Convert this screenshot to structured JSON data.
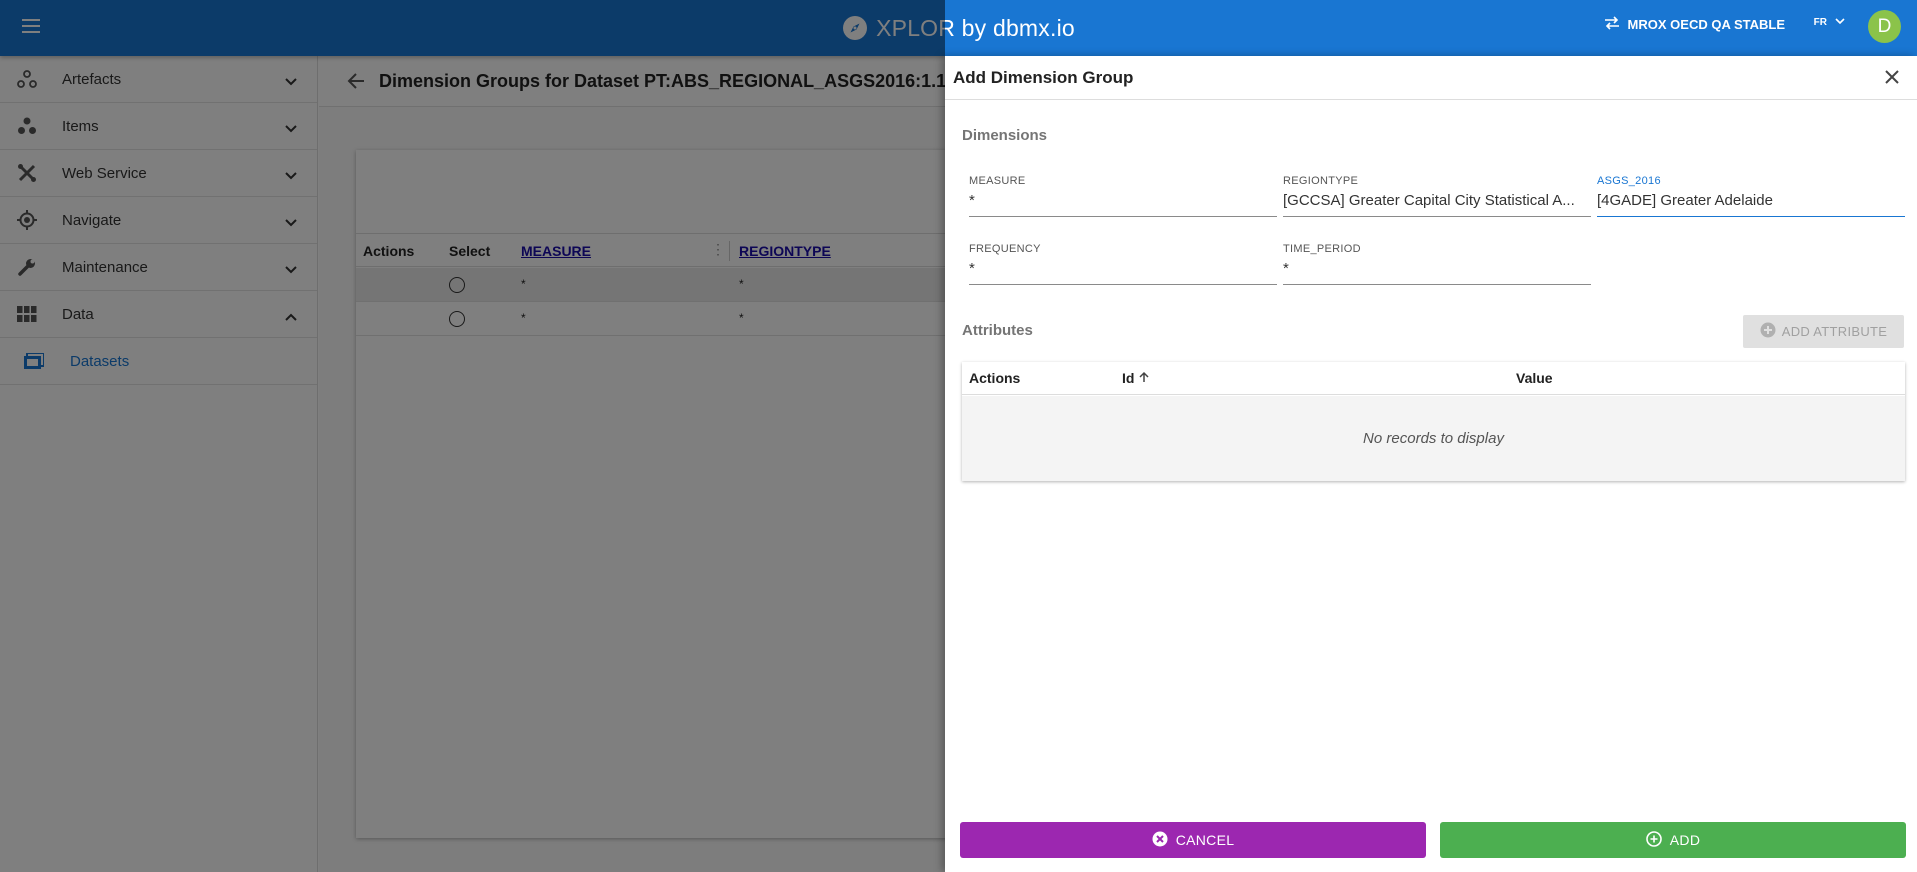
{
  "header": {
    "title": "XPLOR by dbmx.io",
    "environment": "MROX OECD QA STABLE",
    "language": "FR",
    "avatar_initial": "D",
    "colors": {
      "bar": "#1976d2",
      "avatar": "#8bc34a"
    }
  },
  "sidebar": {
    "items": [
      {
        "label": "Artefacts",
        "icon": "artefacts-icon",
        "expanded": false
      },
      {
        "label": "Items",
        "icon": "items-icon",
        "expanded": false
      },
      {
        "label": "Web Service",
        "icon": "web-service-icon",
        "expanded": false
      },
      {
        "label": "Navigate",
        "icon": "navigate-icon",
        "expanded": false
      },
      {
        "label": "Maintenance",
        "icon": "wrench-icon",
        "expanded": false
      },
      {
        "label": "Data",
        "icon": "grid-icon",
        "expanded": true
      }
    ],
    "subitems": [
      {
        "label": "Datasets",
        "icon": "dataset-icon"
      }
    ]
  },
  "page": {
    "title": "Dimension Groups for Dataset PT:ABS_REGIONAL_ASGS2016:1.1",
    "grid": {
      "columns": [
        "Actions",
        "Select",
        "MEASURE",
        "REGIONTYPE"
      ],
      "rows": [
        {
          "measure": "*",
          "regiontype": "*"
        },
        {
          "measure": "*",
          "regiontype": "*"
        }
      ]
    }
  },
  "panel": {
    "title": "Add Dimension Group",
    "dimensions_title": "Dimensions",
    "dimensions": [
      {
        "label": "MEASURE",
        "value": "*"
      },
      {
        "label": "REGIONTYPE",
        "value": "[GCCSA] Greater Capital City Statistical A..."
      },
      {
        "label": "ASGS_2016",
        "value": "[4GADE] Greater Adelaide"
      },
      {
        "label": "FREQUENCY",
        "value": "*"
      },
      {
        "label": "TIME_PERIOD",
        "value": "*"
      }
    ],
    "attributes_title": "Attributes",
    "add_attribute_label": "ADD ATTRIBUTE",
    "attr_columns": {
      "actions": "Actions",
      "id": "Id",
      "value": "Value"
    },
    "empty_message": "No records to display",
    "cancel_label": "CANCEL",
    "add_label": "ADD",
    "colors": {
      "cancel": "#9c27b0",
      "add": "#4caf50"
    }
  }
}
